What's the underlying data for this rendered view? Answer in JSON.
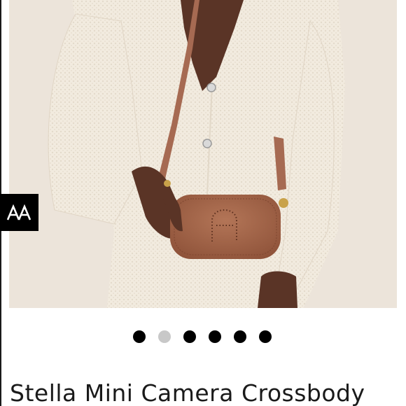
{
  "brand": {
    "logo_text": "AA",
    "logo_icon": "brand-logo-icon"
  },
  "gallery": {
    "image_count": 6,
    "active_index": 1,
    "dot_color_active": "#000000",
    "dot_color_inactive": "#c8c8c8"
  },
  "product": {
    "title": "Stella Mini Camera Crossbody"
  },
  "colors": {
    "bag": "#a8684a",
    "strap": "#a66a52",
    "cardigan": "#f2ebdf",
    "backdrop": "#ece4da"
  }
}
